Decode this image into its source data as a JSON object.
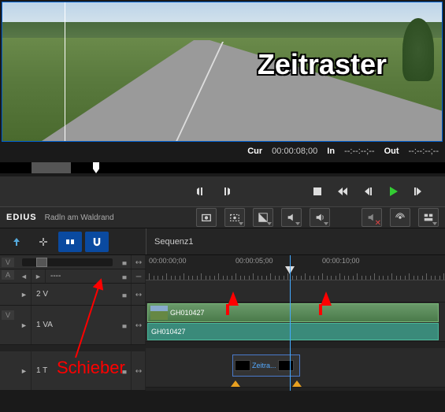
{
  "preview": {
    "overlay": "Zeitraster"
  },
  "timecode": {
    "cur_lbl": "Cur",
    "cur": "00:00:08;00",
    "in_lbl": "In",
    "in": "--:--:--;--",
    "out_lbl": "Out",
    "out": "--:--:--;--"
  },
  "transport": {
    "set_in": "set-in",
    "set_out": "set-out",
    "stop": "stop",
    "rew": "rewind",
    "prev": "prev-frame",
    "play": "play",
    "next": "next-frame"
  },
  "app": {
    "logo": "EDIUS",
    "project": "Radln am Waldrand"
  },
  "toolbar": {
    "capture": "capture",
    "capture2": "capture-still",
    "contrast": "contrast",
    "vol": "volume",
    "vol2": "pan",
    "undo": "undo",
    "audio_off": "mute",
    "broadcast": "sync",
    "layout": "layout"
  },
  "tools": {
    "mode1": "normal-mode",
    "mode2": "trim-mode",
    "group": "group",
    "snap": "snap"
  },
  "sequence": {
    "name": "Sequenz1"
  },
  "ruler": {
    "t0": "00:00:00;00",
    "t1": "00:00:05;00",
    "t2": "00:00:10;00"
  },
  "tracks": {
    "scale": {
      "v": "V",
      "a": "A",
      "sep": "----"
    },
    "v2": {
      "label": "2 V"
    },
    "va1": {
      "label": "1 VA",
      "v": "V"
    },
    "t1": {
      "label": "1 T"
    }
  },
  "clips": {
    "video": {
      "name": "GH010427"
    },
    "audio": {
      "name": "GH010427"
    },
    "title": {
      "name": "Zeitra..."
    }
  },
  "annotations": {
    "slider": "Schieber"
  },
  "icons": {
    "tri_l": "◄",
    "tri_r": "►",
    "lock": "lock",
    "link": "link",
    "mute": "mute"
  }
}
